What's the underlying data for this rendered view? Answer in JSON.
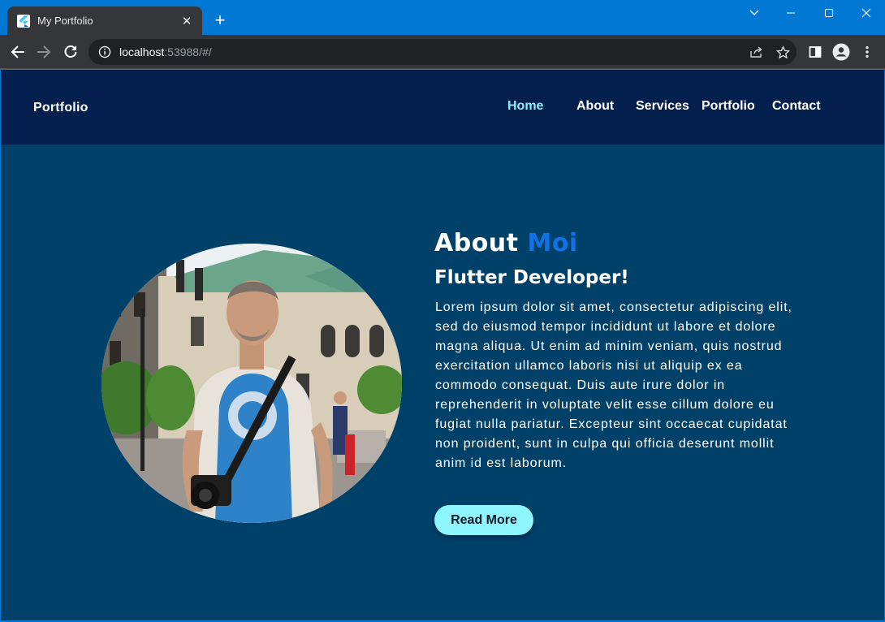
{
  "browser": {
    "tab_title": "My Portfolio",
    "url_host": "localhost",
    "url_rest": ":53988/#/",
    "icons": [
      "flutter-favicon",
      "close-icon",
      "plus-icon",
      "chevron-down-icon",
      "minimize-icon",
      "maximize-icon",
      "close-window-icon",
      "back-arrow-icon",
      "forward-arrow-icon",
      "reload-icon",
      "info-icon",
      "share-icon",
      "star-icon",
      "side-panel-icon",
      "profile-icon",
      "more-vert-icon"
    ]
  },
  "navbar": {
    "brand": "Portfolio",
    "links": [
      "Home",
      "About",
      "Services",
      "Portfolio",
      "Contact"
    ],
    "active_color": "#8ef0ff"
  },
  "hero": {
    "title_part1": "About",
    "title_part2": "Moi",
    "subtitle": "Flutter Developer!",
    "body": "Lorem ipsum dolor sit amet, consectetur adipiscing elit, sed do eiusmod tempor incididunt ut labore et dolore magna aliqua. Ut enim ad minim veniam, quis nostrud exercitation ullamco laboris nisi ut aliquip ex ea commodo consequat. Duis aute irure dolor in reprehenderit in voluptate velit esse cillum dolore eu fugiat nulla pariatur. Excepteur sint occaecat cupidatat non proident, sunt in culpa qui officia deserunt mollit anim id est laborum.",
    "button_label": "Read More",
    "accent_color": "#8ef6ff",
    "title_accent": "#0f73e6"
  },
  "colors": {
    "page_bg": "#00416a",
    "navbar_bg": "#05204f",
    "window_frame": "#0078d4"
  }
}
